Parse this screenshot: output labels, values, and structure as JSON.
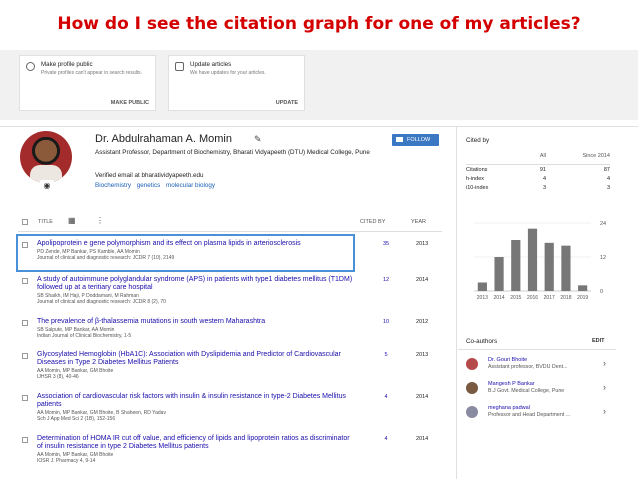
{
  "headline": "How do I see the citation graph for one of my articles?",
  "cards": [
    {
      "title": "Make profile public",
      "subtitle": "Private profiles can't appear in search results.",
      "button": "MAKE PUBLIC",
      "icon": "globe-icon"
    },
    {
      "title": "Update articles",
      "subtitle": "We have updates for your articles.",
      "button": "UPDATE",
      "icon": "library-add-icon"
    }
  ],
  "profile": {
    "name": "Dr. Abdulrahaman A. Momin",
    "affiliation": "Assistant Professor, Department of Biochemistry, Bharati Vidyapeeth (DTU) Medical College, Pune",
    "email": "Verified email at bharatividyapeeth.edu",
    "interests": [
      "Biochemistry",
      "genetics",
      "molecular biology"
    ],
    "follow_label": "FOLLOW"
  },
  "table_header": {
    "title": "TITLE",
    "cited_by": "CITED BY",
    "year": "YEAR"
  },
  "articles": [
    {
      "title": "Apolipoprotein e gene polymorphism and its effect on plasma lipids in arteriosclerosis",
      "authors": "PD Zende, MP Bankar, PS Kamble, AA Momin",
      "journal": "Journal of clinical and diagnostic research: JCDR 7 (10), 2149",
      "cited": "35",
      "year": "2013"
    },
    {
      "title": "A study of autoimmune polyglandular syndrome (APS) in patients with type1 diabetes mellitus (T1DM) followed up at a teritiary care hospital",
      "authors": "SB Shaikh, IM Haji, P Doddamani, M Rahman",
      "journal": "Journal of clinical and diagnostic research: JCDR 8 (2), 70",
      "cited": "12",
      "year": "2014"
    },
    {
      "title": "The prevalence of β-thalassemia mutations in south western Maharashtra",
      "authors": "SB Salpute, MP Bankar, AA Momin",
      "journal": "Indian Journal of Clinical Biochemistry, 1-5",
      "cited": "10",
      "year": "2012"
    },
    {
      "title": "Glycosylated Hemoglobin (HbA1C): Association with Dyslipidemia and Predictor of Cardiovascular Diseases in Type 2 Diabetes Mellitus Patients",
      "authors": "AA Momin, MP Bankar, GM Bhoite",
      "journal": "IJHSR 3 (8), 40-46",
      "cited": "5",
      "year": "2013"
    },
    {
      "title": "Association of cardiovascular risk factors with insulin & insulin resistance in type-2 Diabetes Mellitus patients",
      "authors": "AA Momin, MP Bankar, GM Bhoite, B Shaheen, RD Yadav",
      "journal": "Sch J App Med Sci 2 (1B), 152-156",
      "cited": "4",
      "year": "2014"
    },
    {
      "title": "Determination of HOMA IR cut off value, and efficiency of lipids and lipoprotein ratios as discriminator of insulin resistance in type 2 Diabetes Mellitus patients",
      "authors": "AA Momin, MP Bankar, GM Bhoite",
      "journal": "IOSR J. Pharmacy 4, 9-14",
      "cited": "4",
      "year": "2014"
    }
  ],
  "cited_by": {
    "title": "Cited by",
    "col_all": "All",
    "col_since": "Since 2014",
    "rows": [
      {
        "label": "Citations",
        "all": "91",
        "since": "87"
      },
      {
        "label": "h-index",
        "all": "4",
        "since": "4"
      },
      {
        "label": "i10-index",
        "all": "3",
        "since": "3"
      }
    ]
  },
  "chart_data": {
    "type": "bar",
    "categories": [
      "2013",
      "2014",
      "2015",
      "2016",
      "2017",
      "2018",
      "2019"
    ],
    "values": [
      3,
      12,
      18,
      22,
      17,
      16,
      2
    ],
    "yticks": [
      "24",
      "12",
      "0"
    ],
    "ylim": [
      0,
      24
    ],
    "bar_color": "#777777"
  },
  "coauthors": {
    "title": "Co-authors",
    "edit_label": "EDIT",
    "items": [
      {
        "name": "Dr. Gouri Bhoite",
        "desc": "Assistant professor, BVDU Dent...",
        "color": "#b54a4a"
      },
      {
        "name": "Mangesh P Bankar",
        "desc": "B.J Govt. Medical College, Pune",
        "color": "#7a5a40"
      },
      {
        "name": "meghana padwal",
        "desc": "Professor and Head Department ...",
        "color": "#8a8aa0"
      }
    ]
  }
}
